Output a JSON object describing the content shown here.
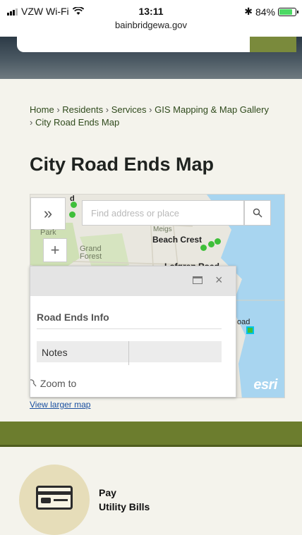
{
  "status_bar": {
    "carrier": "VZW Wi-Fi",
    "time": "13:11",
    "url": "bainbridgewa.gov",
    "bluetooth": "✱",
    "battery_percent": "84%",
    "battery_level": 0.84
  },
  "breadcrumb": {
    "items": [
      "Home",
      "Residents",
      "Services",
      "GIS Mapping & Map Gallery",
      "City Road Ends Map"
    ],
    "separator": "›"
  },
  "page_title": "City Road Ends Map",
  "map": {
    "panel_toggle_icon": "»",
    "search_placeholder": "Find address or place",
    "zoom_in_icon": "+",
    "labels": {
      "park": "Park",
      "grand_forest": "Grand Forest",
      "beach_crest": "Beach Crest",
      "lofgren_road": "Lofgren Road",
      "meigs": "Meigs",
      "road_partial": "oad",
      "d_partial": "d"
    },
    "attribution": "esri",
    "colors": {
      "water": "#a8d5f0",
      "land": "#e9e7df",
      "park": "#cfe0b5",
      "dots": "#3fbf3a",
      "highlight": "#00c3e6"
    }
  },
  "popup": {
    "title": "Road Ends Info",
    "notes_label": "Notes",
    "notes_value": "",
    "zoom_to": "Zoom to",
    "maximize_icon": "□",
    "close_icon": "×"
  },
  "view_larger_map": "View larger map",
  "pay_utility": {
    "line1": "Pay",
    "line2": "Utility Bills"
  }
}
